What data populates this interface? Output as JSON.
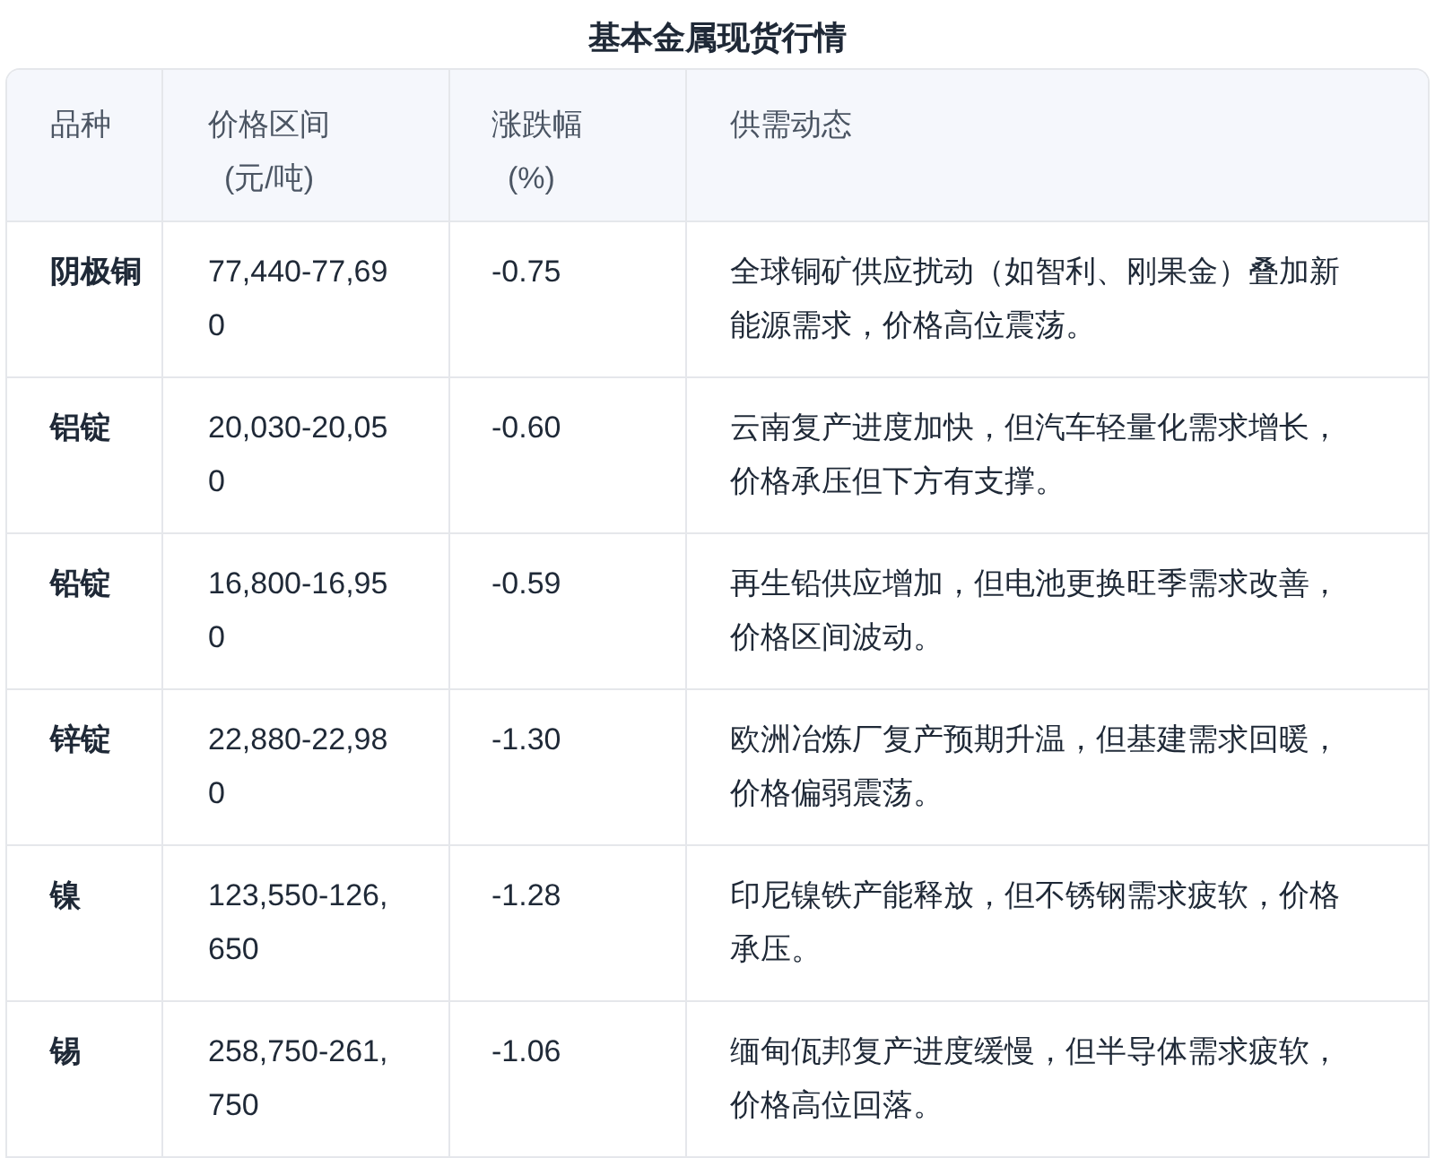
{
  "title": "基本金属现货行情",
  "table": {
    "columns": [
      {
        "label": "品种"
      },
      {
        "label": "价格区间",
        "unit": "(元/吨)"
      },
      {
        "label": "涨跌幅",
        "unit": "(%)"
      },
      {
        "label": "供需动态"
      }
    ],
    "rows": [
      {
        "variety": "阴极铜",
        "price": "77,440-77,690",
        "change": "-0.75",
        "dynamics": "全球铜矿供应扰动（如智利、刚果金）叠加新能源需求，价格高位震荡。"
      },
      {
        "variety": "铝锭",
        "price": "20,030-20,050",
        "change": "-0.60",
        "dynamics": "云南复产进度加快，但汽车轻量化需求增长，价格承压但下方有支撑。"
      },
      {
        "variety": "铅锭",
        "price": "16,800-16,950",
        "change": "-0.59",
        "dynamics": "再生铅供应增加，但电池更换旺季需求改善，价格区间波动。"
      },
      {
        "variety": "锌锭",
        "price": "22,880-22,980",
        "change": "-1.30",
        "dynamics": "欧洲冶炼厂复产预期升温，但基建需求回暖，价格偏弱震荡。"
      },
      {
        "variety": "镍",
        "price": "123,550-126,650",
        "change": "-1.28",
        "dynamics": "印尼镍铁产能释放，但不锈钢需求疲软，价格承压。"
      },
      {
        "variety": "锡",
        "price": "258,750-261,750",
        "change": "-1.06",
        "dynamics": "缅甸佤邦复产进度缓慢，但半导体需求疲软，价格高位回落。"
      }
    ]
  }
}
